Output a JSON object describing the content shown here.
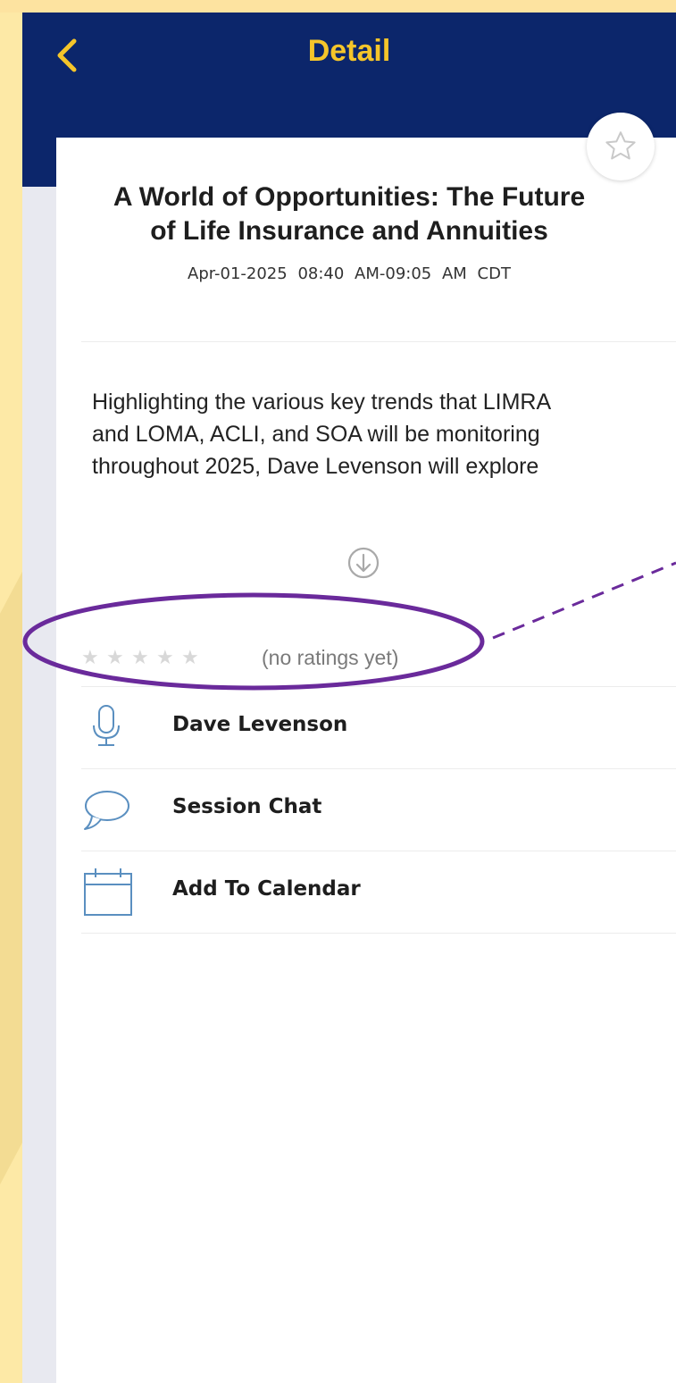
{
  "nav": {
    "title": "Detail"
  },
  "session": {
    "title_line1": "A World of Opportunities: The Future",
    "title_line2": "of Life Insurance and Annuities",
    "date": "Apr-01-2025",
    "time": "08:40 AM-09:05 AM CDT",
    "description_line1": "Highlighting the various key trends that LIMRA",
    "description_line2": "and LOMA, ACLI, and SOA will be monitoring",
    "description_line3": "throughout 2025, Dave Levenson will explore"
  },
  "rating": {
    "text": "(no ratings yet)",
    "stars": 5,
    "value": 0
  },
  "rows": [
    {
      "label": "Dave Levenson",
      "icon": "microphone-icon"
    },
    {
      "label": "Session Chat",
      "icon": "chat-bubble-icon"
    },
    {
      "label": "Add To Calendar",
      "icon": "calendar-icon"
    }
  ],
  "colors": {
    "navbar": "#0c266b",
    "accent": "#f5c52a",
    "icon": "#5a8fc0",
    "annotation": "#6a2a9b",
    "background": "#fde9a6"
  }
}
